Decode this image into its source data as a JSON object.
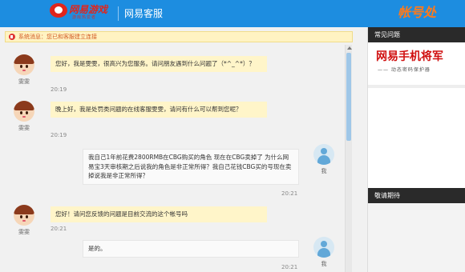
{
  "header": {
    "logo_text": "网易游戏",
    "logo_sub": "游戏热爱者",
    "title": "网易客服",
    "banner": "帐号处"
  },
  "system": {
    "message": "系统消息：您已和客服建立连接"
  },
  "messages": [
    {
      "sender": "雯雯",
      "text": "您好，我是雯雯，很高兴为您服务。请问朋友遇到什么问题了（*^_^*）？",
      "time": "20:19"
    },
    {
      "sender": "雯雯",
      "text": "晚上好，我是处罚类问题的在线客服雯雯，请问有什么可以帮到您呢？",
      "time": "20:19"
    },
    {
      "sender": "我",
      "text": "我自己1年前花费2800RMB在CBG购买的角色 现在在CBG卖掉了  为什么网易宝3天审核期之后说我的角色是非正常所得？我自己花钱CBG买的号现在卖掉说我是非正常所得？",
      "time": "20:21"
    },
    {
      "sender": "雯雯",
      "text": "您好！请问您反馈的问题是目前交流的这个帐号吗",
      "time": "20:21"
    },
    {
      "sender": "我",
      "text": "是的。",
      "time": "20:21"
    }
  ],
  "sidebar": {
    "faq_title": "常见问题",
    "ad_main": "网易手机将军",
    "ad_sub": "—— 动态密码保护器",
    "coming_soon": "敬请期待"
  },
  "colors": {
    "topbar": "#1d8de0",
    "cs_bubble": "#fff5c9",
    "system_text": "#d25a24",
    "ad_red": "#d01010"
  }
}
